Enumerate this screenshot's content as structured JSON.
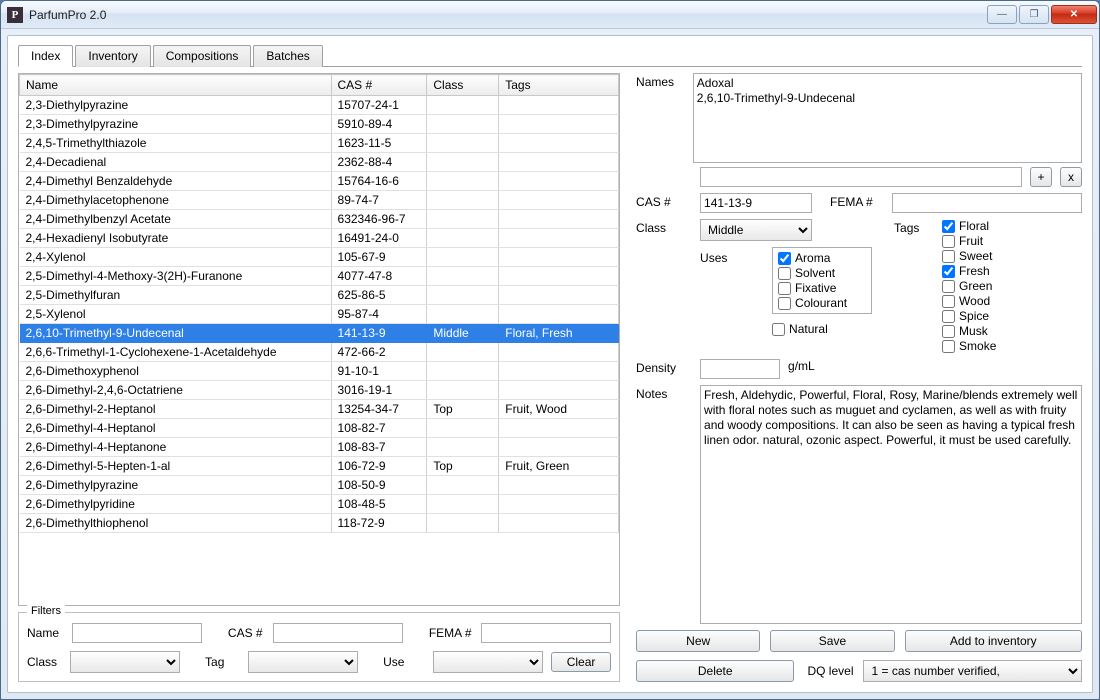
{
  "window": {
    "title": "ParfumPro 2.0",
    "icon_letter": "P"
  },
  "win_buttons": {
    "min": "—",
    "max": "❐",
    "close": "✕"
  },
  "tabs": [
    "Index",
    "Inventory",
    "Compositions",
    "Batches"
  ],
  "active_tab": 0,
  "columns": [
    "Name",
    "CAS #",
    "Class",
    "Tags"
  ],
  "rows": [
    {
      "name": "2,3-Diethylpyrazine",
      "cas": "15707-24-1",
      "cls": "",
      "tags": ""
    },
    {
      "name": "2,3-Dimethylpyrazine",
      "cas": "5910-89-4",
      "cls": "",
      "tags": ""
    },
    {
      "name": "2,4,5-Trimethylthiazole",
      "cas": "1623-11-5",
      "cls": "",
      "tags": ""
    },
    {
      "name": "2,4-Decadienal",
      "cas": "2362-88-4",
      "cls": "",
      "tags": ""
    },
    {
      "name": "2,4-Dimethyl Benzaldehyde",
      "cas": "15764-16-6",
      "cls": "",
      "tags": ""
    },
    {
      "name": "2,4-Dimethylacetophenone",
      "cas": "89-74-7",
      "cls": "",
      "tags": ""
    },
    {
      "name": "2,4-Dimethylbenzyl Acetate",
      "cas": "632346-96-7",
      "cls": "",
      "tags": ""
    },
    {
      "name": "2,4-Hexadienyl Isobutyrate",
      "cas": "16491-24-0",
      "cls": "",
      "tags": ""
    },
    {
      "name": "2,4-Xylenol",
      "cas": "105-67-9",
      "cls": "",
      "tags": ""
    },
    {
      "name": "2,5-Dimethyl-4-Methoxy-3(2H)-Furanone",
      "cas": "4077-47-8",
      "cls": "",
      "tags": ""
    },
    {
      "name": "2,5-Dimethylfuran",
      "cas": "625-86-5",
      "cls": "",
      "tags": ""
    },
    {
      "name": "2,5-Xylenol",
      "cas": "95-87-4",
      "cls": "",
      "tags": ""
    },
    {
      "name": "2,6,10-Trimethyl-9-Undecenal",
      "cas": "141-13-9",
      "cls": "Middle",
      "tags": "Floral, Fresh",
      "sel": true
    },
    {
      "name": "2,6,6-Trimethyl-1-Cyclohexene-1-Acetaldehyde",
      "cas": "472-66-2",
      "cls": "",
      "tags": ""
    },
    {
      "name": "2,6-Dimethoxyphenol",
      "cas": "91-10-1",
      "cls": "",
      "tags": ""
    },
    {
      "name": "2,6-Dimethyl-2,4,6-Octatriene",
      "cas": "3016-19-1",
      "cls": "",
      "tags": ""
    },
    {
      "name": "2,6-Dimethyl-2-Heptanol",
      "cas": "13254-34-7",
      "cls": "Top",
      "tags": "Fruit, Wood"
    },
    {
      "name": "2,6-Dimethyl-4-Heptanol",
      "cas": "108-82-7",
      "cls": "",
      "tags": ""
    },
    {
      "name": "2,6-Dimethyl-4-Heptanone",
      "cas": "108-83-7",
      "cls": "",
      "tags": ""
    },
    {
      "name": "2,6-Dimethyl-5-Hepten-1-al",
      "cas": "106-72-9",
      "cls": "Top",
      "tags": "Fruit, Green"
    },
    {
      "name": "2,6-Dimethylpyrazine",
      "cas": "108-50-9",
      "cls": "",
      "tags": ""
    },
    {
      "name": "2,6-Dimethylpyridine",
      "cas": "108-48-5",
      "cls": "",
      "tags": ""
    },
    {
      "name": "2,6-Dimethylthiophenol",
      "cas": "118-72-9",
      "cls": "",
      "tags": ""
    }
  ],
  "filters": {
    "legend": "Filters",
    "name_label": "Name",
    "cas_label": "CAS #",
    "fema_label": "FEMA #",
    "class_label": "Class",
    "tag_label": "Tag",
    "use_label": "Use",
    "clear": "Clear",
    "name": "",
    "cas": "",
    "fema": "",
    "class": "",
    "tag": "",
    "use": ""
  },
  "detail": {
    "names_label": "Names",
    "names_text": "Adoxal\n2,6,10-Trimethyl-9-Undecenal",
    "alias_input": "",
    "add_btn": "+",
    "remove_btn": "x",
    "cas_label": "CAS #",
    "cas": "141-13-9",
    "fema_label": "FEMA #",
    "fema": "",
    "class_label": "Class",
    "class_value": "Middle",
    "tags_label": "Tags",
    "uses_label": "Uses",
    "uses": [
      {
        "label": "Aroma",
        "checked": true
      },
      {
        "label": "Solvent",
        "checked": false
      },
      {
        "label": "Fixative",
        "checked": false
      },
      {
        "label": "Colourant",
        "checked": false
      }
    ],
    "natural_label": "Natural",
    "natural": false,
    "tags": [
      {
        "label": "Floral",
        "checked": true
      },
      {
        "label": "Fruit",
        "checked": false
      },
      {
        "label": "Sweet",
        "checked": false
      },
      {
        "label": "Fresh",
        "checked": true
      },
      {
        "label": "Green",
        "checked": false
      },
      {
        "label": "Wood",
        "checked": false
      },
      {
        "label": "Spice",
        "checked": false
      },
      {
        "label": "Musk",
        "checked": false
      },
      {
        "label": "Smoke",
        "checked": false
      }
    ],
    "density_label": "Density",
    "density": "",
    "density_unit": "g/mL",
    "notes_label": "Notes",
    "notes": "Fresh, Aldehydic, Powerful, Floral, Rosy, Marine/blends extremely well with floral notes such as muguet and cyclamen, as well as with fruity and woody compositions. It can also be seen as having a typical fresh linen odor. natural, ozonic aspect. Powerful, it must be used carefully."
  },
  "actions": {
    "new": "New",
    "save": "Save",
    "add_inv": "Add to inventory",
    "delete": "Delete",
    "dq_label": "DQ level",
    "dq_value": "1 = cas number verified,"
  }
}
